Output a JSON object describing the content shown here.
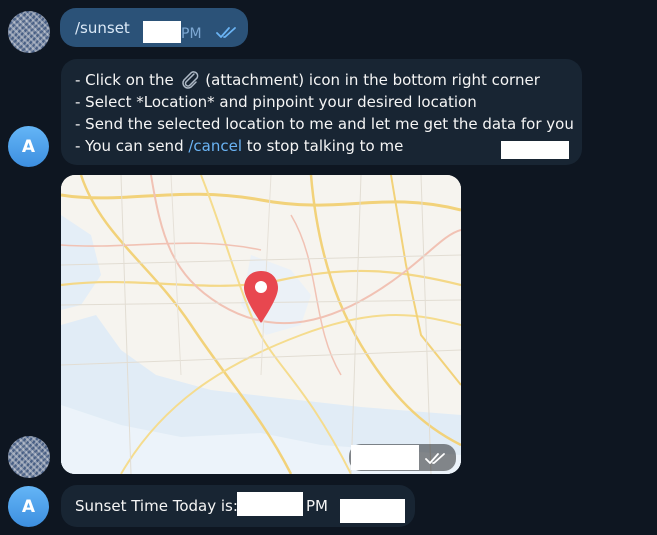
{
  "colors": {
    "background": "#0e1621",
    "outgoing_bubble": "#2b5278",
    "incoming_bubble": "#182533",
    "link": "#6ab3f3",
    "avatar_gradient": "#3d8fe0",
    "map_pin": "#e8474f"
  },
  "messages": {
    "outgoing_command": {
      "text": "/sunset",
      "time_suffix": "PM",
      "status_icon": "double-check-icon"
    },
    "instructions": {
      "avatar_letter": "A",
      "line1_before": "- Click on the ",
      "line1_icon": "paperclip-icon",
      "line1_after": " (attachment) icon in the bottom right corner",
      "line2": "- Select *Location* and pinpoint your desired location",
      "line3": "- Send the selected location to me and let me get the data for you",
      "line4_before": "- You can send ",
      "line4_command": "/cancel",
      "line4_after": " to stop talking to me"
    },
    "location": {
      "pin_icon": "map-pin-icon",
      "status_icon": "double-check-icon"
    },
    "reply": {
      "avatar_letter": "A",
      "label": "Sunset Time Today is:",
      "suffix": "PM"
    }
  }
}
